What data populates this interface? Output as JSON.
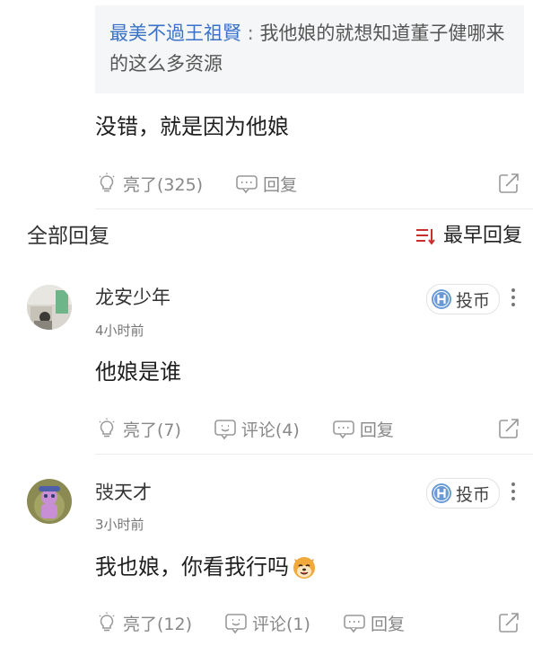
{
  "quote": {
    "author": "最美不過王祖賢",
    "separator": " : ",
    "text": "我他娘的就想知道董子健哪来的这么多资源"
  },
  "post": {
    "text": "没错，就是因为他娘",
    "like_label": "亮了(325)",
    "reply_label": "回复"
  },
  "section": {
    "all_replies": "全部回复",
    "sort_label": "最早回复"
  },
  "replies": [
    {
      "username": "龙安少年",
      "time": "4小时前",
      "coin_label": "投币",
      "text": "他娘是谁",
      "like_label": "亮了(7)",
      "comment_label": "评论(4)",
      "reply_label": "回复"
    },
    {
      "username": "弢天才",
      "time": "3小时前",
      "coin_label": "投币",
      "text": "我也娘，你看我行吗",
      "like_label": "亮了(12)",
      "comment_label": "评论(1)",
      "reply_label": "回复"
    }
  ],
  "colors": {
    "author_link": "#3a72c8",
    "sort_icon": "#c8302f",
    "muted": "#888888",
    "coin_icon": "#6a9ad6"
  },
  "icons": [
    "lightbulb-icon",
    "chat-bubble-icon",
    "comment-icon",
    "share-icon",
    "sort-icon",
    "coin-icon",
    "more-icon",
    "dog-emoji"
  ]
}
